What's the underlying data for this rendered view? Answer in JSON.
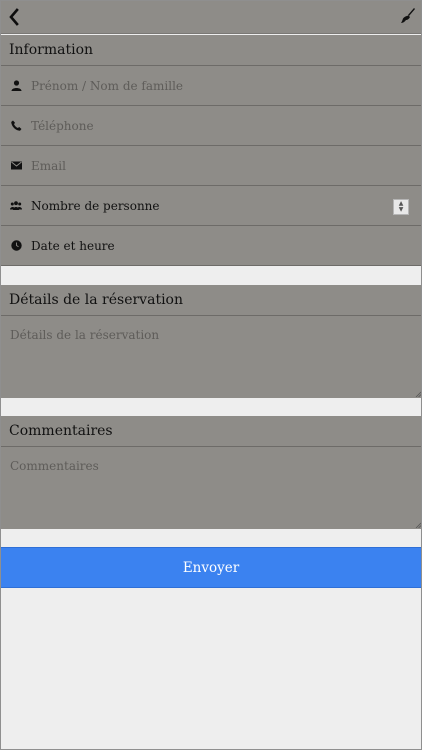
{
  "header": {
    "back_icon": "chevron-left-icon",
    "action_icon": "paint-brush-icon"
  },
  "information": {
    "title": "Information",
    "fields": [
      {
        "icon": "user-icon",
        "placeholder": "Prénom / Nom de famille"
      },
      {
        "icon": "phone-icon",
        "placeholder": "Téléphone"
      },
      {
        "icon": "envelope-icon",
        "placeholder": "Email"
      },
      {
        "icon": "group-icon",
        "value": "Nombre de personne"
      },
      {
        "icon": "clock-icon",
        "value": "Date et heure"
      }
    ]
  },
  "reservation": {
    "title": "Détails de la réservation",
    "placeholder": "Détails de la réservation"
  },
  "comments": {
    "title": "Commentaires",
    "placeholder": "Commentaires"
  },
  "submit": {
    "label": "Envoyer"
  },
  "colors": {
    "panel": "#8e8c88",
    "background": "#eeeeee",
    "accent": "#3b82f0"
  }
}
